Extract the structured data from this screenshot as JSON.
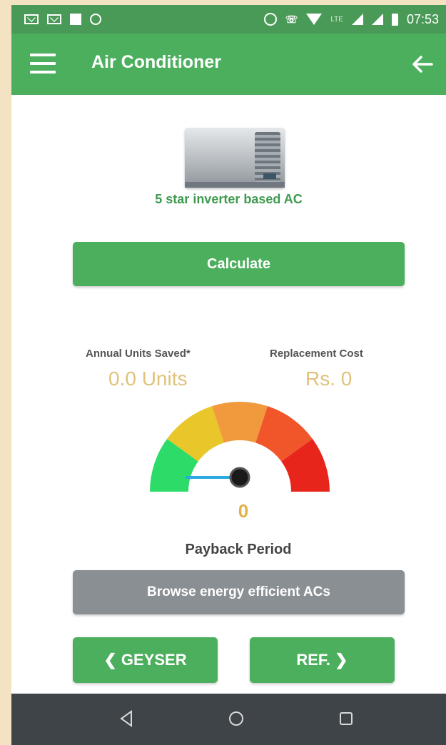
{
  "status_bar": {
    "time": "07:53",
    "lte_label": "LTE",
    "icons": [
      "mail-icon",
      "mail-icon",
      "image-icon",
      "sync-icon",
      "alarm-icon",
      "phone-lte-icon",
      "wifi-icon",
      "signal-icon",
      "signal-icon",
      "battery-icon"
    ]
  },
  "app_bar": {
    "title": "Air Conditioner",
    "menu_icon": "menu-icon",
    "back_icon": "back-arrow-icon"
  },
  "product": {
    "name": "5 star inverter based AC",
    "image": "air-conditioner-image"
  },
  "calculate_button": "Calculate",
  "stats": {
    "annual_units_label": "Annual Units Saved*",
    "annual_units_value": "0.0 Units",
    "replacement_cost_label": "Replacement Cost",
    "replacement_cost_value": "Rs. 0"
  },
  "gauge": {
    "value": "0",
    "needle_level": 0,
    "label": "Payback Period",
    "segment_colors": [
      "#2ddc68",
      "#e9c62a",
      "#f19a3d",
      "#f0562a",
      "#e8251a"
    ],
    "needle_color": "#2aaae0"
  },
  "browse_button": "Browse energy efficient ACs",
  "nav_buttons": {
    "prev": "GEYSER",
    "next": "REF."
  },
  "system_nav": [
    "back-triangle-icon",
    "home-circle-icon",
    "recents-square-icon"
  ],
  "colors": {
    "primary_green": "#4caf5e",
    "value_gold": "#e0c27a",
    "browse_gray": "#8a8f94"
  }
}
